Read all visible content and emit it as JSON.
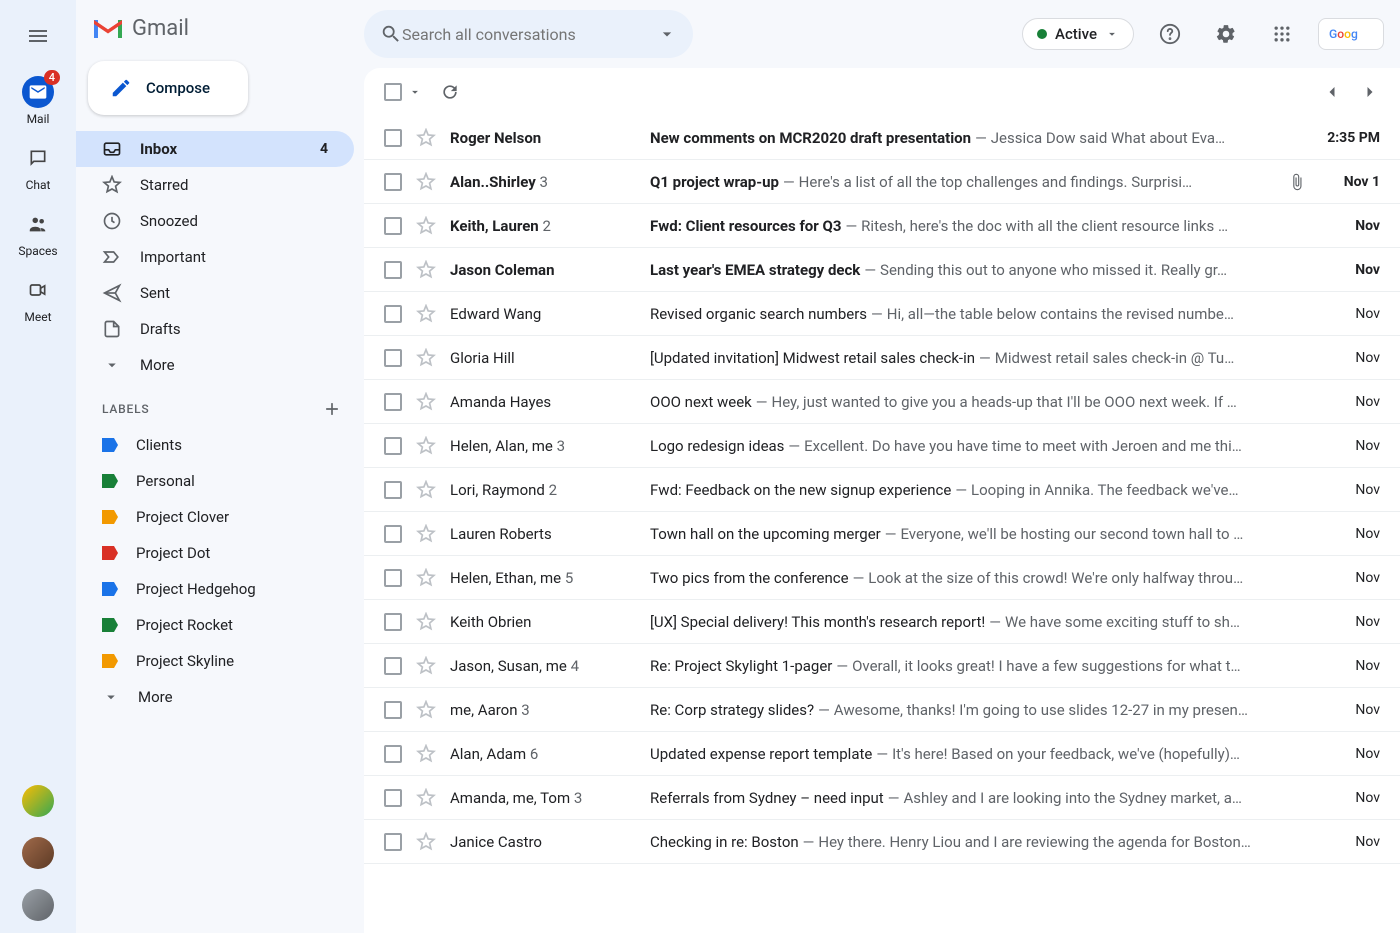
{
  "app": {
    "name": "Gmail"
  },
  "rail": {
    "items": [
      {
        "key": "mail",
        "label": "Mail",
        "active": true,
        "badge": "4"
      },
      {
        "key": "chat",
        "label": "Chat"
      },
      {
        "key": "spaces",
        "label": "Spaces"
      },
      {
        "key": "meet",
        "label": "Meet"
      }
    ]
  },
  "compose": {
    "label": "Compose"
  },
  "nav": [
    {
      "key": "inbox",
      "label": "Inbox",
      "count": "4",
      "active": true,
      "icon": "inbox"
    },
    {
      "key": "starred",
      "label": "Starred",
      "icon": "star"
    },
    {
      "key": "snoozed",
      "label": "Snoozed",
      "icon": "clock"
    },
    {
      "key": "important",
      "label": "Important",
      "icon": "important"
    },
    {
      "key": "sent",
      "label": "Sent",
      "icon": "send"
    },
    {
      "key": "drafts",
      "label": "Drafts",
      "icon": "file"
    },
    {
      "key": "more",
      "label": "More",
      "icon": "chevron"
    }
  ],
  "labels_header": "LABELS",
  "labels": [
    {
      "label": "Clients",
      "color": "#1a73e8"
    },
    {
      "label": "Personal",
      "color": "#188038"
    },
    {
      "label": "Project Clover",
      "color": "#f29900"
    },
    {
      "label": "Project Dot",
      "color": "#d93025"
    },
    {
      "label": "Project Hedgehog",
      "color": "#1a73e8"
    },
    {
      "label": "Project Rocket",
      "color": "#188038"
    },
    {
      "label": "Project Skyline",
      "color": "#f29900"
    },
    {
      "label": "More",
      "color": "",
      "chevron": true
    }
  ],
  "search": {
    "placeholder": "Search all conversations"
  },
  "status": {
    "label": "Active"
  },
  "emails": [
    {
      "unread": true,
      "sender": "Roger Nelson",
      "count": "",
      "subject": "New comments on MCR2020 draft presentation",
      "snippet": "Jessica Dow said What about Eva…",
      "date": "2:35 PM",
      "attach": false
    },
    {
      "unread": true,
      "sender": "Alan..Shirley",
      "count": "3",
      "subject": "Q1 project wrap-up",
      "snippet": "Here's a list of all the top challenges and findings. Surprisi…",
      "date": "Nov 1",
      "attach": true
    },
    {
      "unread": true,
      "sender": "Keith, Lauren",
      "count": "2",
      "subject": "Fwd: Client resources for Q3",
      "snippet": "Ritesh, here's the doc with all the client resource links …",
      "date": "Nov",
      "attach": false
    },
    {
      "unread": true,
      "sender": "Jason Coleman",
      "count": "",
      "subject": "Last year's EMEA strategy deck",
      "snippet": "Sending this out to anyone who missed it. Really gr…",
      "date": "Nov",
      "attach": false
    },
    {
      "unread": false,
      "sender": "Edward Wang",
      "count": "",
      "subject": "Revised organic search numbers",
      "snippet": "Hi, all—the table below contains the revised numbe…",
      "date": "Nov",
      "attach": false
    },
    {
      "unread": false,
      "sender": "Gloria Hill",
      "count": "",
      "subject": "[Updated invitation] Midwest retail sales check-in",
      "snippet": "Midwest retail sales check-in @ Tu…",
      "date": "Nov",
      "attach": false
    },
    {
      "unread": false,
      "sender": "Amanda Hayes",
      "count": "",
      "subject": "OOO next week",
      "snippet": "Hey, just wanted to give you a heads-up that I'll be OOO next week. If …",
      "date": "Nov",
      "attach": false
    },
    {
      "unread": false,
      "sender": "Helen, Alan, me",
      "count": "3",
      "subject": "Logo redesign ideas",
      "snippet": "Excellent. Do have you have time to meet with Jeroen and me thi…",
      "date": "Nov",
      "attach": false
    },
    {
      "unread": false,
      "sender": "Lori, Raymond",
      "count": "2",
      "subject": "Fwd: Feedback on the new signup experience",
      "snippet": "Looping in Annika. The feedback we've…",
      "date": "Nov",
      "attach": false
    },
    {
      "unread": false,
      "sender": "Lauren Roberts",
      "count": "",
      "subject": "Town hall on the upcoming merger",
      "snippet": "Everyone, we'll be hosting our second town hall to …",
      "date": "Nov",
      "attach": false
    },
    {
      "unread": false,
      "sender": "Helen, Ethan, me",
      "count": "5",
      "subject": "Two pics from the conference",
      "snippet": "Look at the size of this crowd! We're only halfway throu…",
      "date": "Nov",
      "attach": false
    },
    {
      "unread": false,
      "sender": "Keith Obrien",
      "count": "",
      "subject": "[UX] Special delivery! This month's research report!",
      "snippet": "We have some exciting stuff to sh…",
      "date": "Nov",
      "attach": false
    },
    {
      "unread": false,
      "sender": "Jason, Susan, me",
      "count": "4",
      "subject": "Re: Project Skylight 1-pager",
      "snippet": "Overall, it looks great! I have a few suggestions for what t…",
      "date": "Nov",
      "attach": false
    },
    {
      "unread": false,
      "sender": "me, Aaron",
      "count": "3",
      "subject": "Re: Corp strategy slides?",
      "snippet": "Awesome, thanks! I'm going to use slides 12-27 in my presen…",
      "date": "Nov",
      "attach": false
    },
    {
      "unread": false,
      "sender": "Alan, Adam",
      "count": "6",
      "subject": "Updated expense report template",
      "snippet": "It's here! Based on your feedback, we've (hopefully)…",
      "date": "Nov",
      "attach": false
    },
    {
      "unread": false,
      "sender": "Amanda, me, Tom",
      "count": "3",
      "subject": "Referrals from Sydney – need input",
      "snippet": "Ashley and I are looking into the Sydney market, a…",
      "date": "Nov",
      "attach": false
    },
    {
      "unread": false,
      "sender": "Janice Castro",
      "count": "",
      "subject": "Checking in re: Boston",
      "snippet": "Hey there. Henry Liou and I are reviewing the agenda for Boston…",
      "date": "Nov",
      "attach": false
    }
  ]
}
